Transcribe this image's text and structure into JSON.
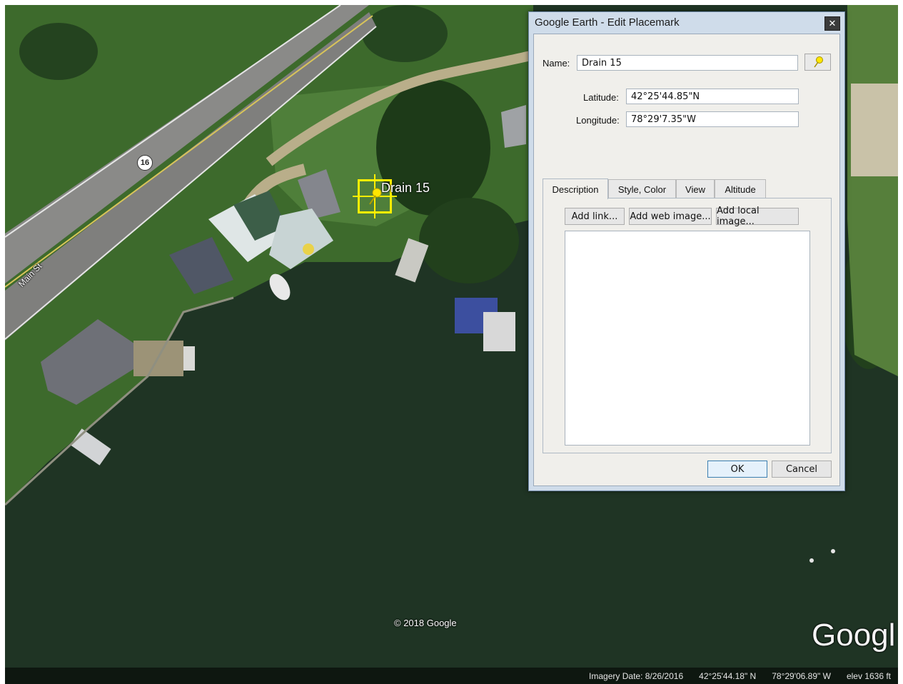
{
  "map": {
    "road_number": "16",
    "street_name": "Main St",
    "placemark_label": "Drain 15",
    "copyright": "© 2018 Google",
    "logo": "Googl",
    "status": {
      "imagery_date": "Imagery Date: 8/26/2016",
      "latitude": "42°25'44.18\" N",
      "longitude": "78°29'06.89\" W",
      "elevation": "elev  1636 ft"
    }
  },
  "dialog": {
    "title": "Google Earth - Edit Placemark",
    "close_label": "✕",
    "name_label": "Name:",
    "name_value": "Drain 15",
    "latitude_label": "Latitude:",
    "latitude_value": "42°25'44.85\"N",
    "longitude_label": "Longitude:",
    "longitude_value": "78°29'7.35\"W",
    "tabs": [
      {
        "label": "Description",
        "active": true
      },
      {
        "label": "Style, Color",
        "active": false
      },
      {
        "label": "View",
        "active": false
      },
      {
        "label": "Altitude",
        "active": false
      }
    ],
    "add_link_label": "Add link...",
    "add_web_image_label": "Add web image...",
    "add_local_image_label": "Add local image...",
    "description_value": "",
    "ok_label": "OK",
    "cancel_label": "Cancel"
  },
  "colors": {
    "placemark": "#ffee00",
    "water": "#1e3323",
    "grass": "#3f6b2e",
    "road": "#8c8c8c"
  }
}
